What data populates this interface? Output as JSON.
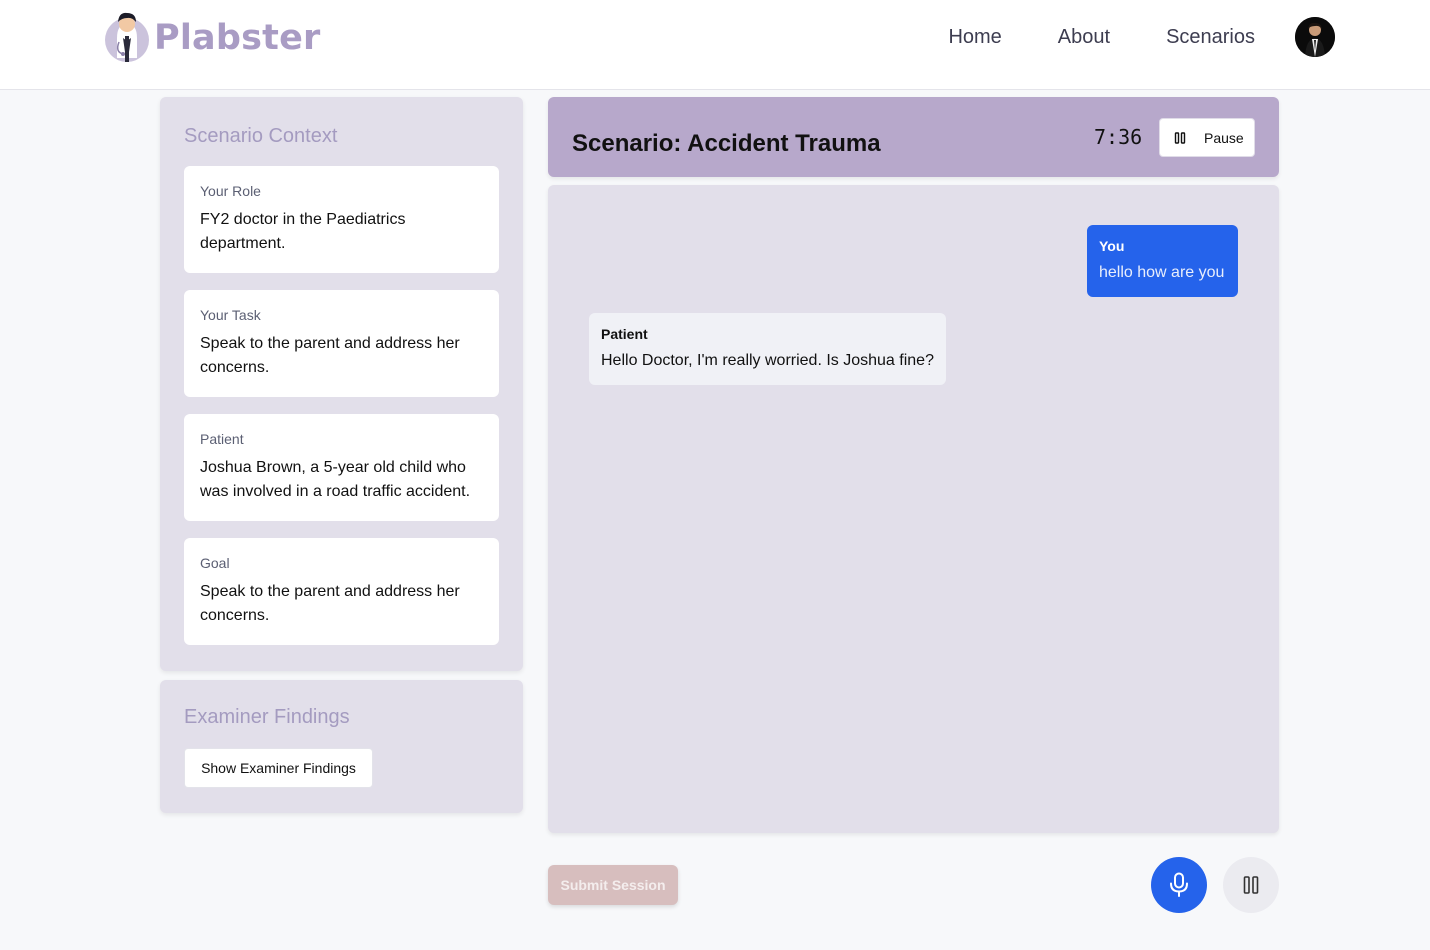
{
  "brand": {
    "name": "Plabster",
    "logo_icon": "doctor-mascot-icon"
  },
  "nav": {
    "items": [
      "Home",
      "About",
      "Scenarios"
    ]
  },
  "profile": {
    "avatar_icon": "user-avatar"
  },
  "scenario_context": {
    "title": "Scenario Context",
    "cards": [
      {
        "label": "Your Role",
        "value": "FY2 doctor in the Paediatrics department."
      },
      {
        "label": "Your Task",
        "value": "Speak to the parent and address her concerns."
      },
      {
        "label": "Patient",
        "value": "Joshua Brown, a 5-year old child who was involved in a road traffic accident."
      },
      {
        "label": "Goal",
        "value": "Speak to the parent and address her concerns."
      }
    ]
  },
  "examiner": {
    "title": "Examiner Findings",
    "button_label": "Show Examiner Findings"
  },
  "scenario_header": {
    "title": "Scenario: Accident Trauma",
    "timer": "7:36",
    "pause_label": "Pause",
    "pause_icon": "pause-icon"
  },
  "chat": {
    "messages": [
      {
        "sender": "You",
        "text": "hello how are you"
      },
      {
        "sender": "Patient",
        "text": "Hello Doctor, I'm really worried. Is Joshua fine?"
      }
    ]
  },
  "controls": {
    "submit_label": "Submit Session",
    "mic_icon": "microphone-icon",
    "pause_icon": "pause-icon"
  },
  "colors": {
    "accent": "#2563eb",
    "header_purple": "#b7a8cb",
    "panel": "#e2dfea",
    "brand": "#a99cc4",
    "submit_disabled": "#d7bebe"
  }
}
